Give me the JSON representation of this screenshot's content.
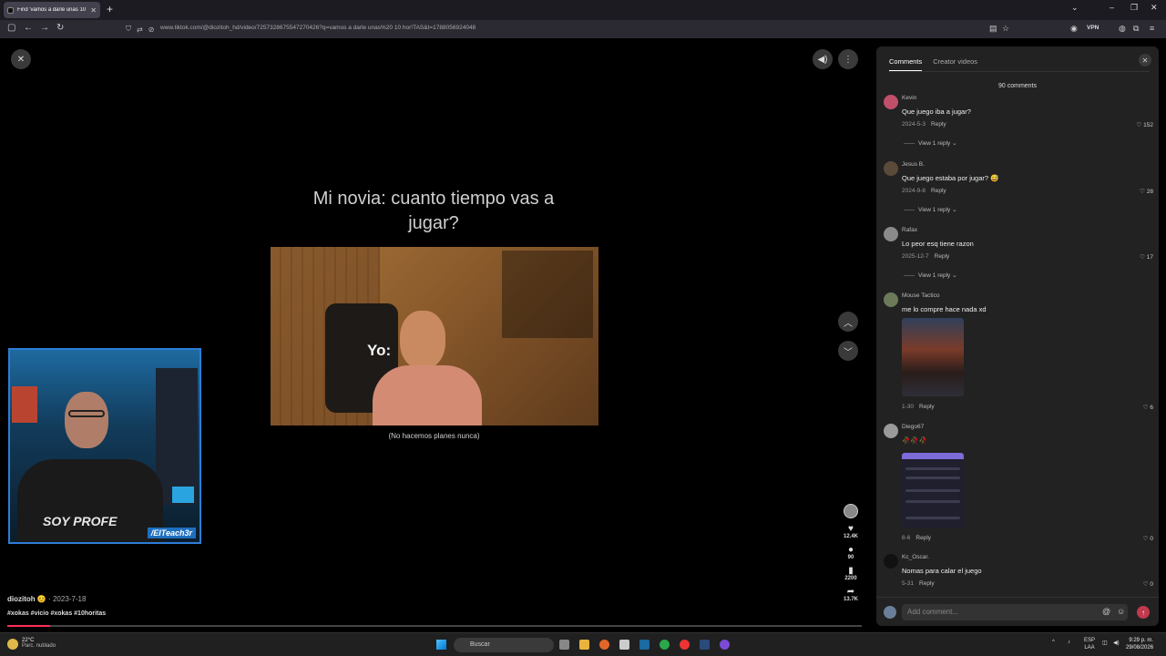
{
  "browser": {
    "tab_title": "Find 'vamos a darle unas 10 ho",
    "url": "www.tiktok.com/@diozitoh_hd/video/7257328675547270426?q=vamos a darle unas%20 10 hor!TAS&t=1788056924048",
    "vpn_label": "VPN"
  },
  "video": {
    "caption_top": "Mi novia: cuanto tiempo vas a jugar?",
    "clip_label_yo": "Yo:",
    "caption_bottom": "(No hacemos planes nunca)",
    "webcam_shirt": "SOY PROFE",
    "webcam_handle": "/ElTeach3r",
    "author": "diozitoh",
    "date": "2023-7-18",
    "tags": "#xokas #vicio #xokas #10horitas",
    "progress": 0.05,
    "actions": [
      {
        "icon": "heart-icon",
        "count": "12.4K"
      },
      {
        "icon": "comment-icon",
        "count": "90"
      },
      {
        "icon": "bookmark-icon",
        "count": "2200"
      },
      {
        "icon": "share-icon",
        "count": "13.7K"
      }
    ]
  },
  "panel": {
    "tabs": [
      "Comments",
      "Creator videos"
    ],
    "count_label": "90 comments",
    "placeholder": "Add comment...",
    "comments": [
      {
        "name": "Kevin",
        "text": "Que juego iba a jugar?",
        "date": "2024-5-3",
        "reply": "Reply",
        "likes": "152",
        "replies": "View 1 reply"
      },
      {
        "name": "Jesus B.",
        "text": "Que juego estaba por jugar? 😅",
        "date": "2024-9-8",
        "reply": "Reply",
        "likes": "28",
        "replies": "View 1 reply"
      },
      {
        "name": "Rafax",
        "text": "Lo peor esq tiene razon",
        "date": "2025-12-7",
        "reply": "Reply",
        "likes": "17",
        "replies": "View 1 reply"
      },
      {
        "name": "Mouse Tactico",
        "text": "me lo compre hace nada xd",
        "date": "1-30",
        "reply": "Reply",
        "likes": "6"
      },
      {
        "name": "Diego67",
        "text": "🥀🥀🥀",
        "date": "8-6",
        "reply": "Reply",
        "likes": "0"
      },
      {
        "name": "Kc_Oscar.",
        "text": "Nomas para calar el juego",
        "date": "5-31",
        "reply": "Reply",
        "likes": "0"
      }
    ]
  },
  "taskbar": {
    "temp": "22°C",
    "weather": "Parc. nublado",
    "search": "Buscar",
    "lang1": "ESP",
    "lang2": "LAA",
    "time": "9:29 p. m.",
    "date": "29/08/2026"
  }
}
